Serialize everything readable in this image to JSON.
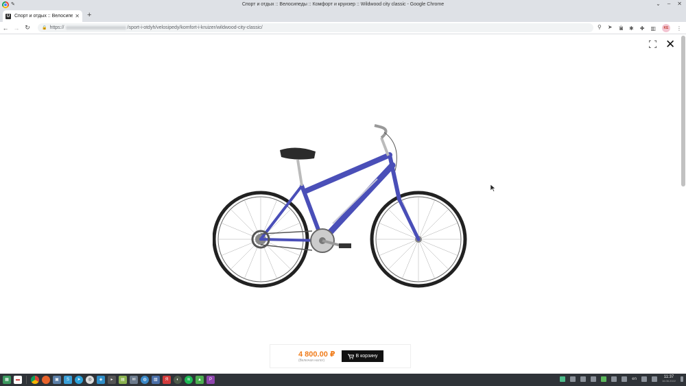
{
  "window": {
    "title": "Спорт и отдых :: Велосипеды :: Комфорт и круизер :: Wildwood city classic - Google Chrome",
    "controls": [
      "⌄",
      "–",
      "✕"
    ]
  },
  "tab": {
    "label": "Спорт и отдых :: Велосипед",
    "close": "✕",
    "new_tab": "+"
  },
  "address_bar": {
    "scheme": "https://",
    "path": "/sport-i-otdyh/velosipedy/komfort-i-kruizer/wildwood-city-classic/"
  },
  "profile": {
    "initials": "KE"
  },
  "lightbox": {
    "close": "✕"
  },
  "product": {
    "image_icon": "bicycle-image",
    "price": "4 800.00 ₽",
    "tax_note": "(Включая налог)",
    "cart_button": "В корзину",
    "colors": {
      "price": "#f07c1a",
      "button_bg": "#111111",
      "frame": "#4a4fb8"
    }
  },
  "taskbar": {
    "language": "en",
    "time": "11:37",
    "date": "16.06.2022"
  }
}
